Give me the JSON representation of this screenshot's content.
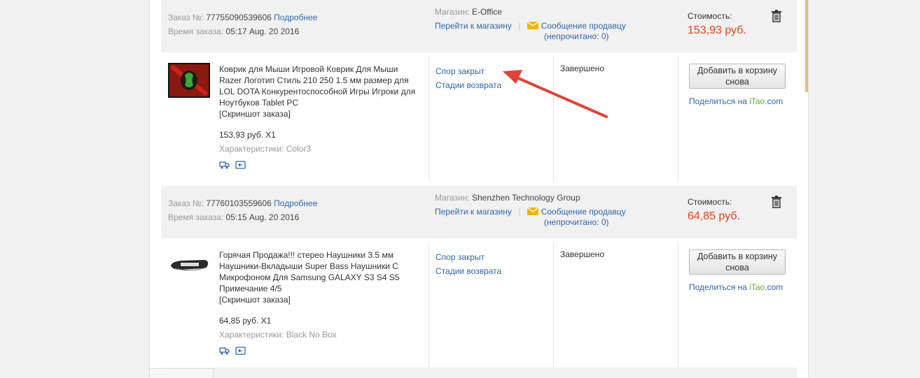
{
  "labels": {
    "order_no": "Заказ №:",
    "details": "Подробнее",
    "order_time": "Время заказа:",
    "shop": "Магазин:",
    "go_to_shop": "Перейти к магазину",
    "separator": "|",
    "message_seller": "Сообщение продавцу",
    "unread_prefix": "(непрочитано: ",
    "unread_suffix": ")",
    "cost": "Стоимость:",
    "screenshot": "[Скриншот заказа]",
    "characteristics": "Характеристики:",
    "dispute_closed": "Спор закрыт",
    "return_stages": "Стадии возврата",
    "status_done": "Завершено",
    "add_to_cart": "Добавить в корзину снова",
    "share_on": "Поделиться на ",
    "itao": "iTao",
    "itao_domain": ".com"
  },
  "orders": [
    {
      "number": "77755090539606",
      "time": "05:17 Aug. 20 2016",
      "shop": "E-Office",
      "unread": "0",
      "cost": "153,93 руб.",
      "item_title": "Коврик для Мыши Игровой Коврик Для Мыши Razer Логотип Стиль 210 250 1.5 мм размер для LOL DOTA Конкурентоспособной Игры Игроки для Ноутбуков Tablet PC",
      "item_price_qty": "153,93 руб. X1",
      "characteristics": "Color3"
    },
    {
      "number": "77760103559606",
      "time": "05:15 Aug. 20 2016",
      "shop": "Shenzhen Technology Group",
      "unread": "0",
      "cost": "64,85 руб.",
      "item_title": "Горячая Продажа!!! стерео Наушники 3.5 мм Наушники-Вкладыши Super Bass Наушники С Микрофоном Для Samsung GALAXY S3 S4 S5 Примечание 4/5",
      "item_price_qty": "64,85 руб. X1",
      "characteristics": "Black No Box"
    }
  ],
  "colors": {
    "price": "#e2411d",
    "link": "#3366aa",
    "arrow": "#e0433a",
    "itao_green": "#66a830"
  }
}
